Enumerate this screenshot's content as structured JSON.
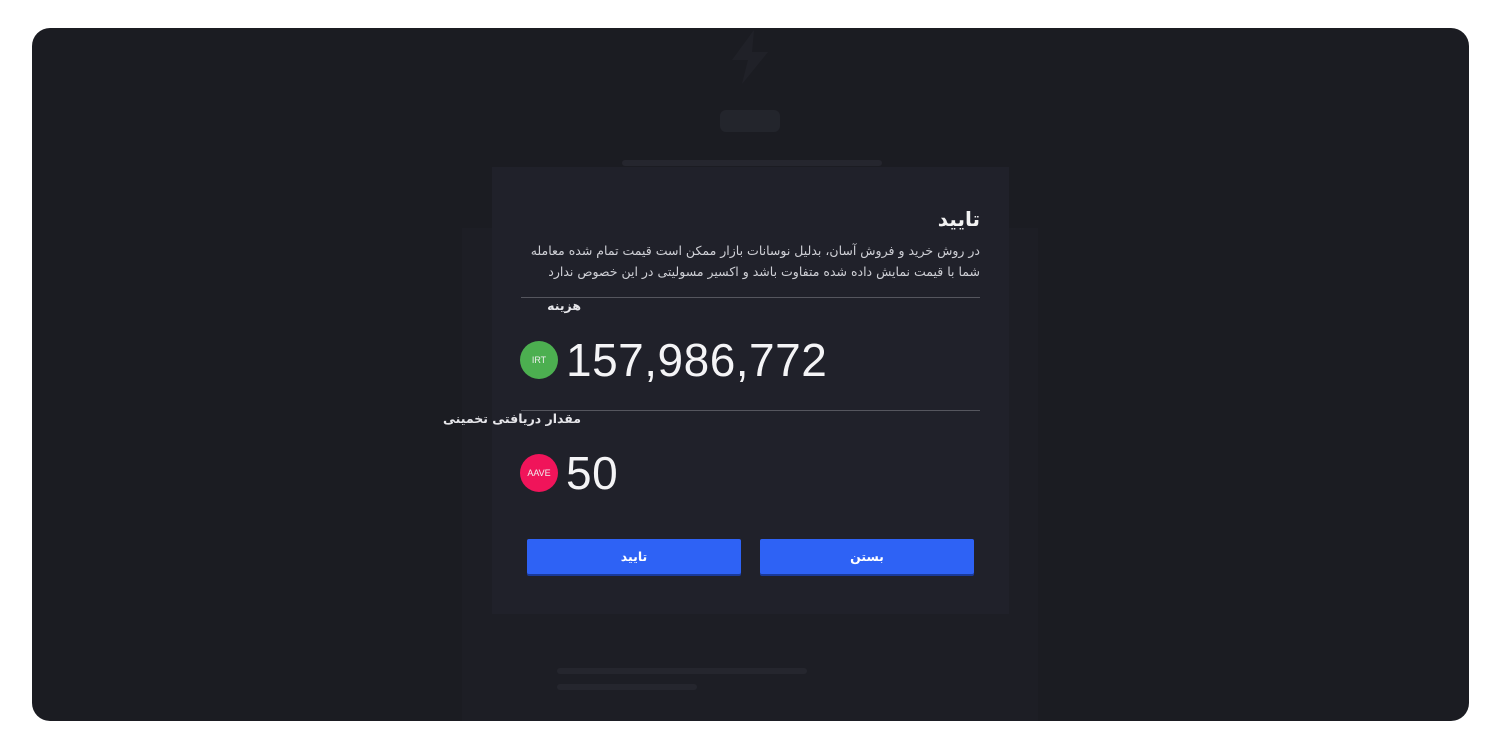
{
  "modal": {
    "title": "تایید",
    "description": "در روش خرید و فروش آسان، بدلیل نوسانات بازار ممکن است قیمت تمام شده معامله شما با قیمت نمایش داده شده متفاوت باشد و اکسیر مسولیتی در این خصوص ندارد",
    "cost": {
      "label": "هزینه",
      "amount": "157,986,772",
      "currency": "IRT",
      "currency_color": "#4caf50"
    },
    "receive": {
      "label": "مقدار دریافتی تخمینی",
      "amount": "50",
      "currency": "AAVE",
      "currency_color": "#f0145a"
    },
    "buttons": {
      "close_label": "بستن",
      "confirm_label": "تایید"
    }
  },
  "colors": {
    "accent": "#2e62f5",
    "modal_bg": "#20212a",
    "page_bg": "#1b1c22"
  },
  "icons": {
    "background_logo": "lightning-bolt-icon"
  }
}
